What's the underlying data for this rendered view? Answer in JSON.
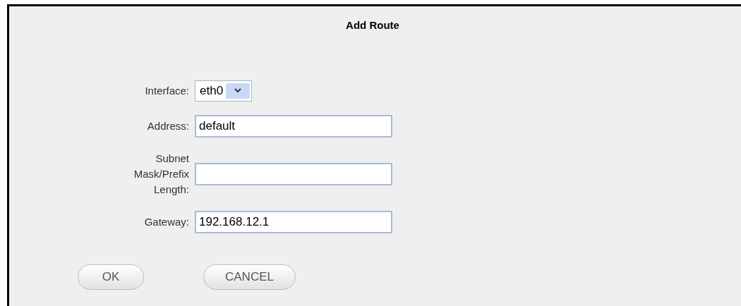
{
  "dialog": {
    "title": "Add Route"
  },
  "fields": [
    {
      "kind": "select",
      "label": "Interface:",
      "value": "eth0"
    },
    {
      "kind": "text",
      "label": "Address:",
      "value": "default"
    },
    {
      "kind": "text",
      "label": "Subnet Mask/Prefix Length:"
    },
    {
      "kind": "text",
      "label": "Gateway:",
      "value": "192.168.12.1"
    }
  ],
  "buttons": [
    "OK",
    "CANCEL"
  ]
}
